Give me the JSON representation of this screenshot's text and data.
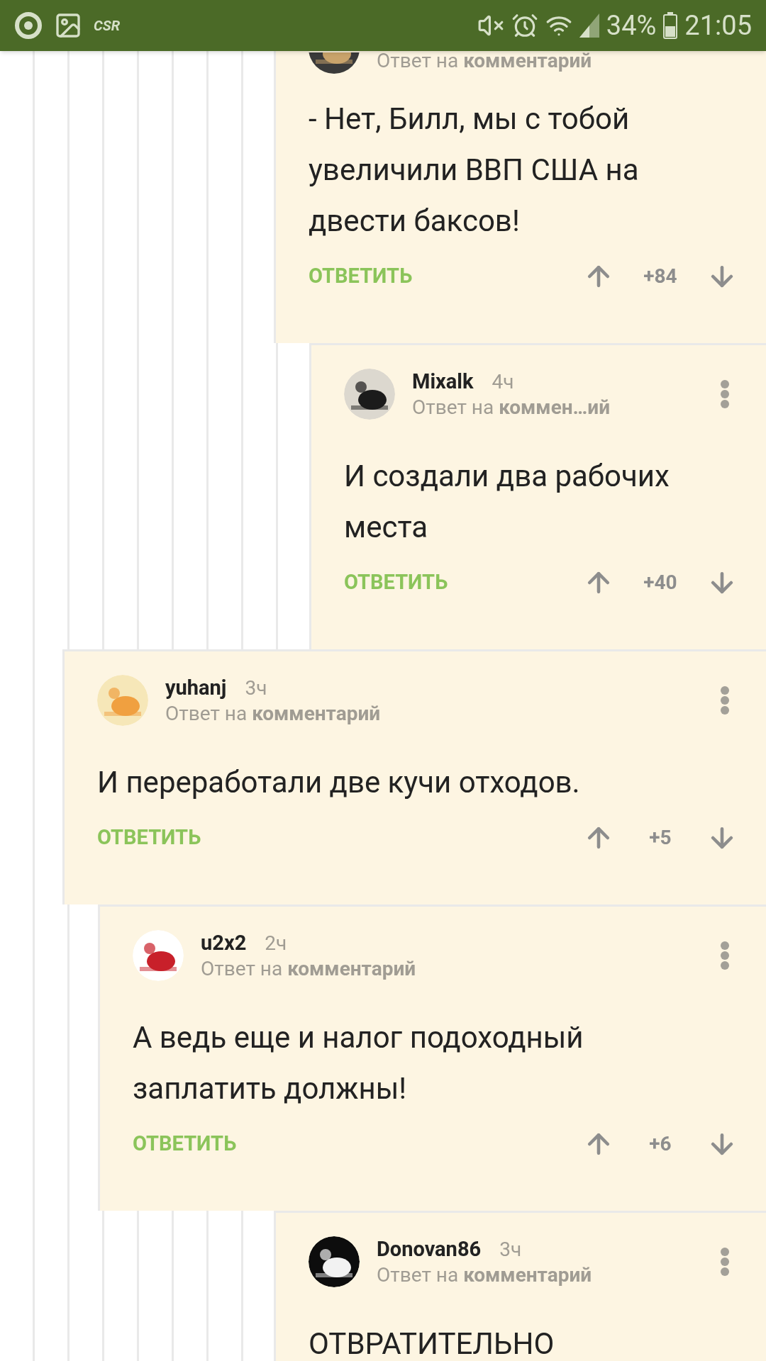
{
  "status_bar": {
    "app_label": "CSR",
    "battery": "34%",
    "time": "21:05"
  },
  "comments": [
    {
      "reply_to": "Ответ на **комментарий**",
      "text": "- Нет, Билл, мы с тобой увеличили ВВП США на двести баксов!",
      "reply_label": "ОТВЕТИТЬ",
      "score": "+84",
      "children": [
        {
          "author": "Mixalk",
          "time": "4ч",
          "reply_to": "Ответ на **коммен…ий**",
          "text": "И создали два рабочих места",
          "reply_label": "ОТВЕТИТЬ",
          "score": "+40"
        }
      ]
    },
    {
      "author": "yuhanj",
      "time": "3ч",
      "reply_to": "Ответ на **комментарий**",
      "text": "И переработали две кучи отходов.",
      "reply_label": "ОТВЕТИТЬ",
      "score": "+5",
      "children": [
        {
          "author": "u2x2",
          "time": "2ч",
          "reply_to": "Ответ на **комментарий**",
          "text": "А ведь еще и налог подоходный заплатить должны!",
          "reply_label": "ОТВЕТИТЬ",
          "score": "+6"
        }
      ]
    },
    {
      "author": "Donovan86",
      "time": "3ч",
      "reply_to": "Ответ на **комментарий**",
      "text": "ОТВРАТИТЕЛЬНО"
    }
  ]
}
